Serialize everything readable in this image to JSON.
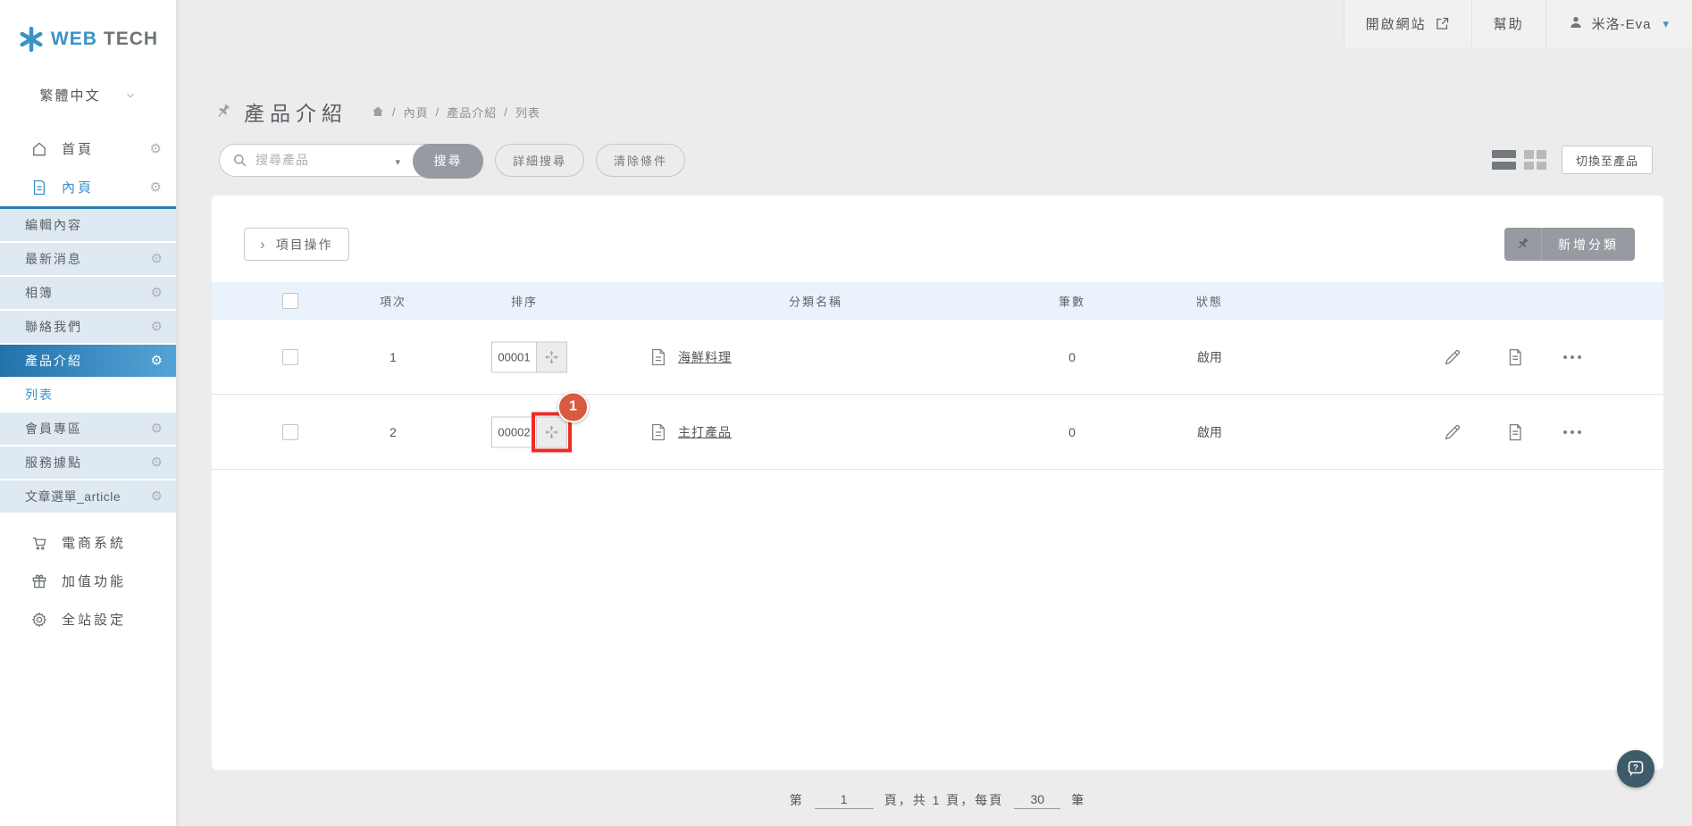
{
  "brand": {
    "web": "WEB",
    "tech": "TECH"
  },
  "icons": {
    "gear": "⚙",
    "chevron_right": "›",
    "triangle_down": "▾"
  },
  "sidebar": {
    "language": "繁體中文",
    "top_items": [
      {
        "label": "首頁"
      },
      {
        "label": "內頁"
      }
    ],
    "sub_items": [
      "編輯內容",
      "最新消息",
      "相簿",
      "聯絡我們",
      "產品介紹",
      "列表",
      "會員專區",
      "服務據點",
      "文章選單_article"
    ],
    "bottom_items": [
      "電商系統",
      "加值功能",
      "全站設定"
    ]
  },
  "topbar": {
    "open_site": "開啟網站",
    "help": "幫助",
    "user": "米洛-Eva"
  },
  "page": {
    "title": "產品介紹",
    "breadcrumb_sep": "/",
    "breadcrumb": [
      "內頁",
      "產品介紹",
      "列表"
    ]
  },
  "search": {
    "placeholder": "搜尋產品",
    "search_btn": "搜尋",
    "advanced_btn": "詳細搜尋",
    "clear_btn": "清除條件"
  },
  "view": {
    "switch_btn": "切換至產品"
  },
  "card": {
    "item_actions_btn": "項目操作",
    "add_category_btn": "新增分類"
  },
  "table": {
    "headers": {
      "index": "項次",
      "sort": "排序",
      "name": "分類名稱",
      "count": "筆數",
      "status": "狀態"
    },
    "rows": [
      {
        "index": "1",
        "sort": "00001",
        "name": "海鮮料理",
        "count": "0",
        "status": "啟用"
      },
      {
        "index": "2",
        "sort": "00002",
        "name": "主打產品",
        "count": "0",
        "status": "啟用"
      }
    ]
  },
  "annotation": {
    "badge": "1"
  },
  "pagination": {
    "prefix": "第",
    "page": "1",
    "middle": "頁，共 1 頁，每頁",
    "per_page": "30",
    "suffix": "筆"
  },
  "colors": {
    "accent": "#3a92c8",
    "active_start": "#2472aa",
    "active_end": "#55a3d6",
    "sub_bg": "#dfe9f1",
    "badge": "#d85b3f",
    "annotation": "#ee2b24",
    "btn_gray": "#969ba1",
    "table_header_bg": "#eaf3fb",
    "fab_bg": "#3d5b68"
  }
}
